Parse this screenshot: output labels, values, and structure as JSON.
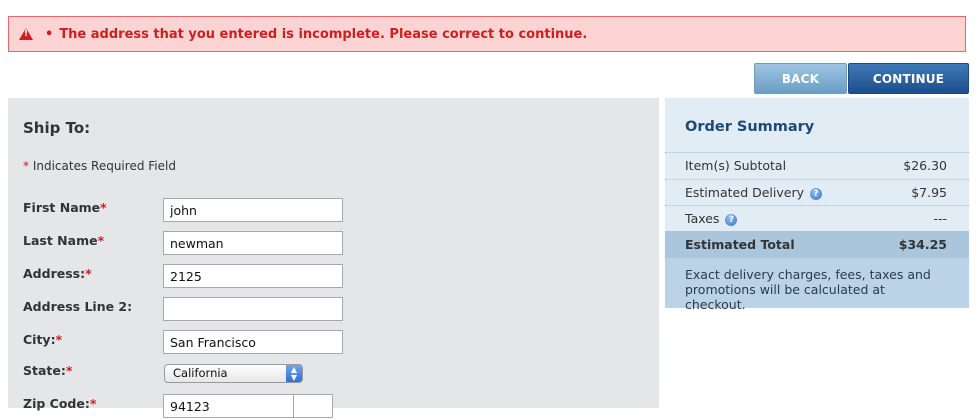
{
  "alert": {
    "bullet": "•",
    "message": "The address that you entered is incomplete. Please correct to continue."
  },
  "nav": {
    "back_label": "BACK",
    "continue_label": "CONTINUE"
  },
  "ship_to": {
    "title": "Ship To:",
    "required_star": "*",
    "required_note": "Indicates Required Field",
    "fields": [
      {
        "label": "First Name",
        "required": true,
        "value": ""
      },
      {
        "label": "Last Name",
        "required": true,
        "value": ""
      },
      {
        "label": "Address:",
        "required": true,
        "value": ""
      },
      {
        "label": "Address Line 2:",
        "required": false,
        "value": ""
      },
      {
        "label": "City:",
        "required": true,
        "value": ""
      },
      {
        "label": "State:",
        "required": true,
        "value": ""
      },
      {
        "label": "Zip Code:",
        "required": true,
        "value": ""
      }
    ],
    "first_name": {
      "label": "First Name",
      "star": "*",
      "value": "john"
    },
    "last_name": {
      "label": "Last Name",
      "star": "*",
      "value": "newman"
    },
    "address": {
      "label": "Address:",
      "star": "*",
      "value": "2125"
    },
    "address2": {
      "label": "Address Line 2:",
      "value": ""
    },
    "city": {
      "label": "City:",
      "star": "*",
      "value": "San Francisco"
    },
    "state": {
      "label": "State:",
      "star": "*",
      "value": "California"
    },
    "zip": {
      "label": "Zip Code:",
      "star": "*",
      "value": "94123"
    }
  },
  "summary": {
    "title": "Order Summary",
    "subtotal": {
      "label": "Item(s) Subtotal",
      "value": "$26.30"
    },
    "delivery": {
      "label": "Estimated Delivery",
      "value": "$7.95"
    },
    "taxes": {
      "label": "Taxes",
      "value": "---"
    },
    "total": {
      "label": "Estimated Total",
      "value": "$34.25"
    },
    "note": "Exact delivery charges, fees, taxes and promotions will be calculated at checkout.",
    "help_glyph": "?"
  },
  "colors": {
    "alert_red": "#cc1f1f",
    "alert_bg": "#fdd3d3",
    "button_blue": "#1d4e8a",
    "summary_title": "#1e4a7a"
  },
  "icons": {
    "alert": "warning-triangle-icon",
    "help": "help-circle-icon",
    "select_arrows": "updown-arrows-icon"
  }
}
